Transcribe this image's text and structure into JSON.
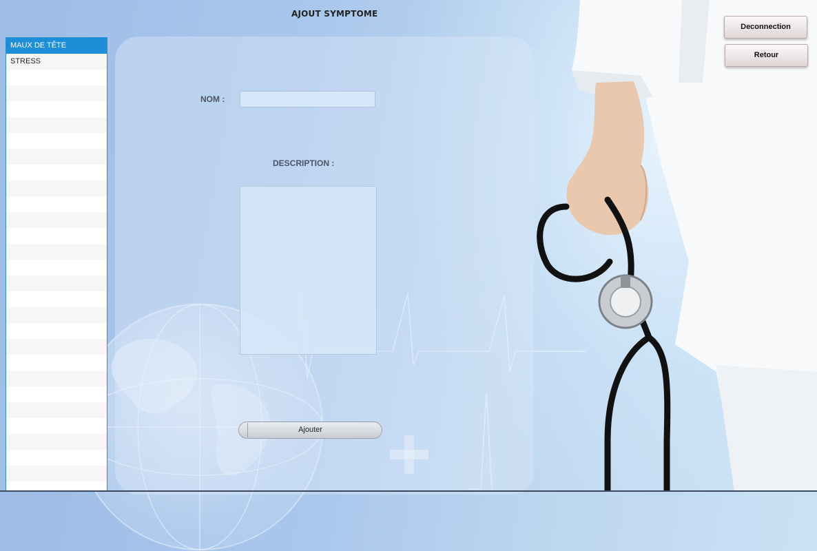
{
  "window": {
    "title": "AJOUT SYMPTOME"
  },
  "symptom_list": {
    "items": [
      {
        "label": "MAUX DE TÊTE",
        "selected": true
      },
      {
        "label": "STRESS",
        "selected": false
      }
    ],
    "selected_color": "#1e8ed8"
  },
  "form": {
    "nom_label": "NOM :",
    "nom_value": "",
    "description_label": "DESCRIPTION :",
    "description_value": "",
    "submit_label": "Ajouter"
  },
  "actions": {
    "logout_label": "Deconnection",
    "back_label": "Retour"
  },
  "icons": {
    "background": "doctor-stethoscope-illustration",
    "globe": "globe-icon",
    "cross": "medical-cross-icon",
    "ecg": "heartbeat-line-icon"
  }
}
